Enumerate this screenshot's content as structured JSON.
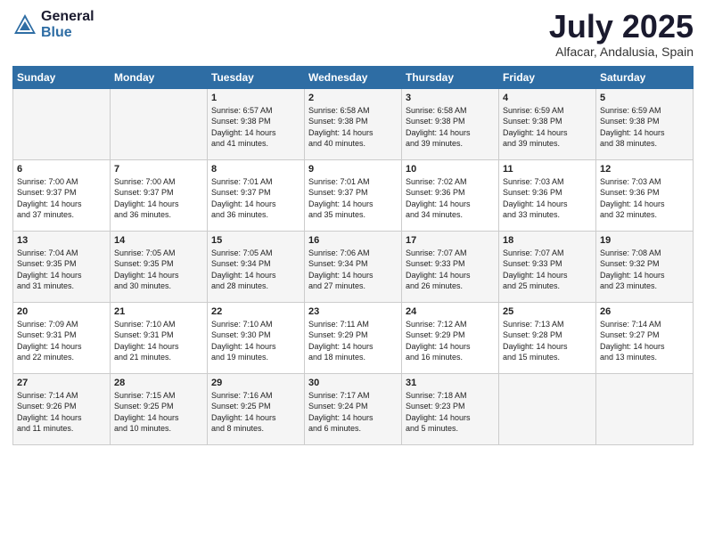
{
  "header": {
    "logo_general": "General",
    "logo_blue": "Blue",
    "month_title": "July 2025",
    "location": "Alfacar, Andalusia, Spain"
  },
  "days_of_week": [
    "Sunday",
    "Monday",
    "Tuesday",
    "Wednesday",
    "Thursday",
    "Friday",
    "Saturday"
  ],
  "weeks": [
    [
      {
        "day": "",
        "info": ""
      },
      {
        "day": "",
        "info": ""
      },
      {
        "day": "1",
        "info": "Sunrise: 6:57 AM\nSunset: 9:38 PM\nDaylight: 14 hours\nand 41 minutes."
      },
      {
        "day": "2",
        "info": "Sunrise: 6:58 AM\nSunset: 9:38 PM\nDaylight: 14 hours\nand 40 minutes."
      },
      {
        "day": "3",
        "info": "Sunrise: 6:58 AM\nSunset: 9:38 PM\nDaylight: 14 hours\nand 39 minutes."
      },
      {
        "day": "4",
        "info": "Sunrise: 6:59 AM\nSunset: 9:38 PM\nDaylight: 14 hours\nand 39 minutes."
      },
      {
        "day": "5",
        "info": "Sunrise: 6:59 AM\nSunset: 9:38 PM\nDaylight: 14 hours\nand 38 minutes."
      }
    ],
    [
      {
        "day": "6",
        "info": "Sunrise: 7:00 AM\nSunset: 9:37 PM\nDaylight: 14 hours\nand 37 minutes."
      },
      {
        "day": "7",
        "info": "Sunrise: 7:00 AM\nSunset: 9:37 PM\nDaylight: 14 hours\nand 36 minutes."
      },
      {
        "day": "8",
        "info": "Sunrise: 7:01 AM\nSunset: 9:37 PM\nDaylight: 14 hours\nand 36 minutes."
      },
      {
        "day": "9",
        "info": "Sunrise: 7:01 AM\nSunset: 9:37 PM\nDaylight: 14 hours\nand 35 minutes."
      },
      {
        "day": "10",
        "info": "Sunrise: 7:02 AM\nSunset: 9:36 PM\nDaylight: 14 hours\nand 34 minutes."
      },
      {
        "day": "11",
        "info": "Sunrise: 7:03 AM\nSunset: 9:36 PM\nDaylight: 14 hours\nand 33 minutes."
      },
      {
        "day": "12",
        "info": "Sunrise: 7:03 AM\nSunset: 9:36 PM\nDaylight: 14 hours\nand 32 minutes."
      }
    ],
    [
      {
        "day": "13",
        "info": "Sunrise: 7:04 AM\nSunset: 9:35 PM\nDaylight: 14 hours\nand 31 minutes."
      },
      {
        "day": "14",
        "info": "Sunrise: 7:05 AM\nSunset: 9:35 PM\nDaylight: 14 hours\nand 30 minutes."
      },
      {
        "day": "15",
        "info": "Sunrise: 7:05 AM\nSunset: 9:34 PM\nDaylight: 14 hours\nand 28 minutes."
      },
      {
        "day": "16",
        "info": "Sunrise: 7:06 AM\nSunset: 9:34 PM\nDaylight: 14 hours\nand 27 minutes."
      },
      {
        "day": "17",
        "info": "Sunrise: 7:07 AM\nSunset: 9:33 PM\nDaylight: 14 hours\nand 26 minutes."
      },
      {
        "day": "18",
        "info": "Sunrise: 7:07 AM\nSunset: 9:33 PM\nDaylight: 14 hours\nand 25 minutes."
      },
      {
        "day": "19",
        "info": "Sunrise: 7:08 AM\nSunset: 9:32 PM\nDaylight: 14 hours\nand 23 minutes."
      }
    ],
    [
      {
        "day": "20",
        "info": "Sunrise: 7:09 AM\nSunset: 9:31 PM\nDaylight: 14 hours\nand 22 minutes."
      },
      {
        "day": "21",
        "info": "Sunrise: 7:10 AM\nSunset: 9:31 PM\nDaylight: 14 hours\nand 21 minutes."
      },
      {
        "day": "22",
        "info": "Sunrise: 7:10 AM\nSunset: 9:30 PM\nDaylight: 14 hours\nand 19 minutes."
      },
      {
        "day": "23",
        "info": "Sunrise: 7:11 AM\nSunset: 9:29 PM\nDaylight: 14 hours\nand 18 minutes."
      },
      {
        "day": "24",
        "info": "Sunrise: 7:12 AM\nSunset: 9:29 PM\nDaylight: 14 hours\nand 16 minutes."
      },
      {
        "day": "25",
        "info": "Sunrise: 7:13 AM\nSunset: 9:28 PM\nDaylight: 14 hours\nand 15 minutes."
      },
      {
        "day": "26",
        "info": "Sunrise: 7:14 AM\nSunset: 9:27 PM\nDaylight: 14 hours\nand 13 minutes."
      }
    ],
    [
      {
        "day": "27",
        "info": "Sunrise: 7:14 AM\nSunset: 9:26 PM\nDaylight: 14 hours\nand 11 minutes."
      },
      {
        "day": "28",
        "info": "Sunrise: 7:15 AM\nSunset: 9:25 PM\nDaylight: 14 hours\nand 10 minutes."
      },
      {
        "day": "29",
        "info": "Sunrise: 7:16 AM\nSunset: 9:25 PM\nDaylight: 14 hours\nand 8 minutes."
      },
      {
        "day": "30",
        "info": "Sunrise: 7:17 AM\nSunset: 9:24 PM\nDaylight: 14 hours\nand 6 minutes."
      },
      {
        "day": "31",
        "info": "Sunrise: 7:18 AM\nSunset: 9:23 PM\nDaylight: 14 hours\nand 5 minutes."
      },
      {
        "day": "",
        "info": ""
      },
      {
        "day": "",
        "info": ""
      }
    ]
  ]
}
